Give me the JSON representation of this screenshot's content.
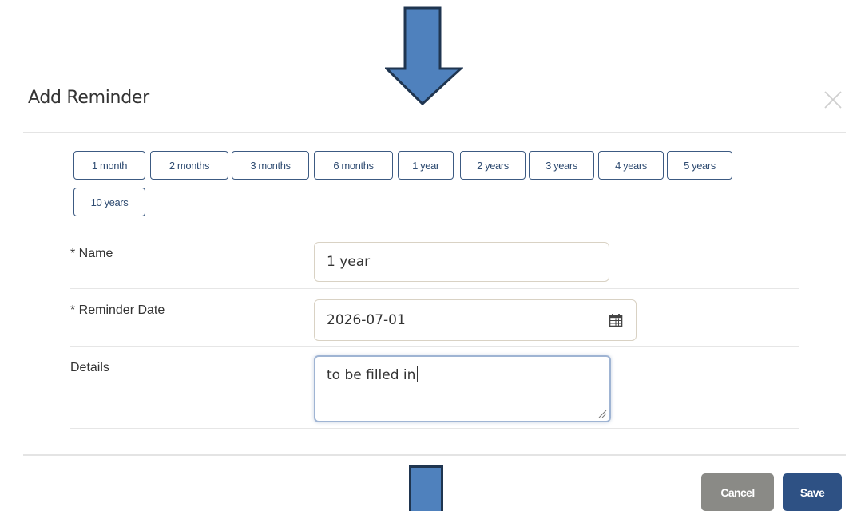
{
  "dialog": {
    "title": "Add Reminder"
  },
  "quick_buttons": [
    "1 month",
    "2 months",
    "3 months",
    "6 months",
    "1 year",
    "2 years",
    "3 years",
    "4 years",
    "5 years",
    "10 years"
  ],
  "form": {
    "name_label": "* Name",
    "name_value": "1 year",
    "date_label": "* Reminder Date",
    "date_value": "2026-07-01",
    "details_label": "Details",
    "details_value": "to be filled in"
  },
  "footer": {
    "cancel_label": "Cancel",
    "save_label": "Save"
  },
  "icons": {
    "close": "close-icon",
    "calendar": "calendar-icon",
    "annotation": "arrow-down-icon"
  },
  "colors": {
    "arrow_fill": "#4f81bd",
    "arrow_stroke": "#1f3550",
    "button_border": "#3c5a82",
    "save_bg": "#2e5184",
    "cancel_bg": "#8a8a86"
  }
}
